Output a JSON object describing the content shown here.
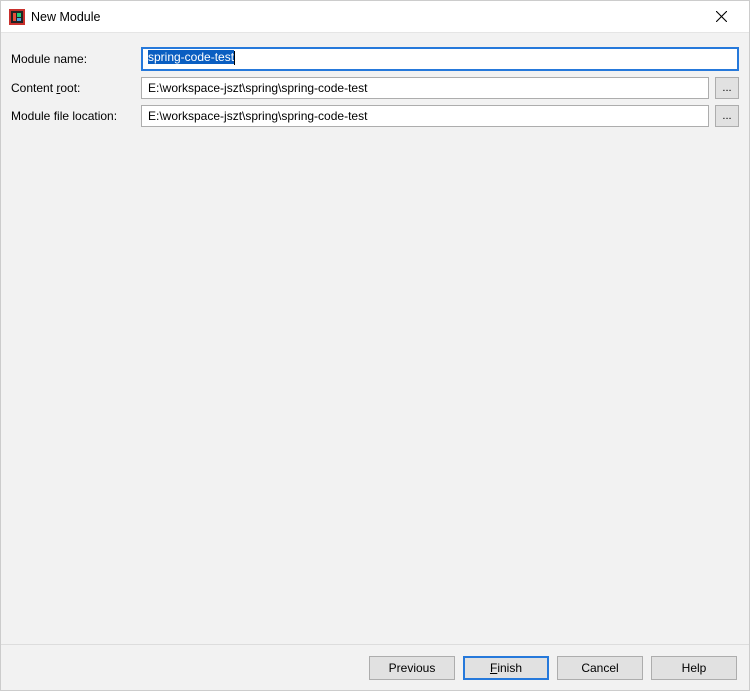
{
  "window": {
    "title": "New Module"
  },
  "form": {
    "module_name": {
      "label": "Module name:",
      "value": "spring-code-test"
    },
    "content_root": {
      "label_pre": "Content ",
      "label_accel": "r",
      "label_post": "oot:",
      "value": "E:\\workspace-jszt\\spring\\spring-code-test",
      "browse": "..."
    },
    "module_file_location": {
      "label": "Module file location:",
      "value": "E:\\workspace-jszt\\spring\\spring-code-test",
      "browse": "..."
    }
  },
  "buttons": {
    "previous": "Previous",
    "finish_accel": "F",
    "finish_rest": "inish",
    "cancel": "Cancel",
    "help": "Help"
  }
}
